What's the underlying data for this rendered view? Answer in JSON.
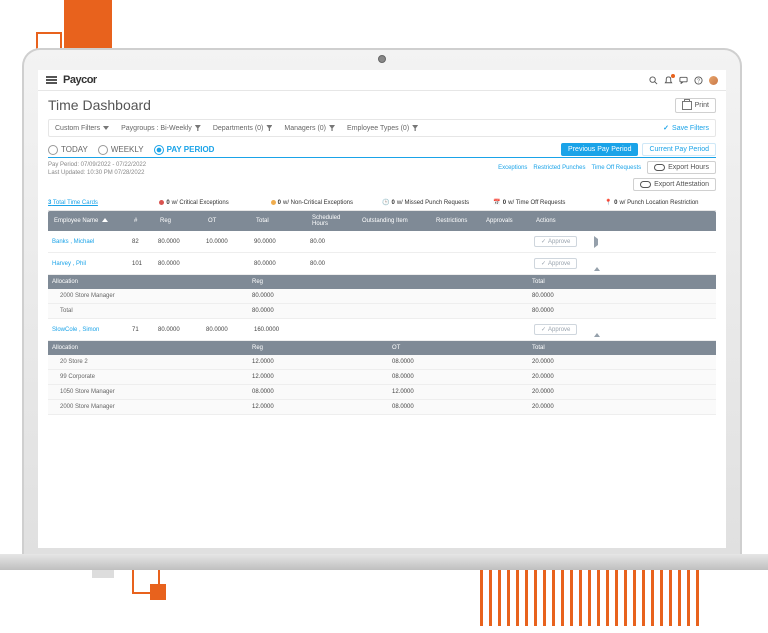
{
  "header": {
    "logo": "Paycor",
    "icons": [
      "search-icon",
      "bell-icon",
      "chat-icon",
      "help-icon",
      "avatar"
    ]
  },
  "page": {
    "title": "Time Dashboard",
    "print": "Print"
  },
  "filters": {
    "custom": "Custom Filters",
    "paygroups": "Paygroups : Bi-Weekly",
    "departments": "Departments (0)",
    "managers": "Managers (0)",
    "emptypes": "Employee Types (0)",
    "save": "Save Filters"
  },
  "ranges": {
    "today": "TODAY",
    "weekly": "WEEKLY",
    "payperiod": "PAY PERIOD",
    "prev": "Previous Pay Period",
    "curr": "Current Pay Period"
  },
  "meta": {
    "period": "Pay Period: 07/09/2022 - 07/22/2022",
    "updated": "Last Updated: 10:30 PM 07/28/2022",
    "tabs": {
      "exc": "Exceptions",
      "restr": "Restricted Punches",
      "tor": "Time Off Requests"
    },
    "exportHours": "Export Hours",
    "exportAtt": "Export Attestation"
  },
  "summary": {
    "total": {
      "n": "3",
      "label": "Total Time Cards"
    },
    "crit": {
      "n": "0",
      "label": "w/ Critical Exceptions"
    },
    "noncrit": {
      "n": "0",
      "label": "w/ Non-Critical Exceptions"
    },
    "missed": {
      "n": "0",
      "label": "w/ Missed Punch Requests"
    },
    "tor": {
      "n": "0",
      "label": "w/ Time Off Requests"
    },
    "loc": {
      "n": "0",
      "label": "w/ Punch Location Restriction"
    }
  },
  "cols": {
    "name": "Employee Name",
    "num": "#",
    "reg": "Reg",
    "ot": "OT",
    "total": "Total",
    "sched": "Scheduled Hours",
    "out": "Outstanding Item",
    "restr": "Restrictions",
    "appr": "Approvals",
    "act": "Actions"
  },
  "rows": [
    {
      "name": "Banks , Michael",
      "num": "82",
      "reg": "80.0000",
      "ot": "10.0000",
      "total": "90.0000",
      "sched": "80.00",
      "approve": "Approve",
      "expand": "right"
    },
    {
      "name": "Harvey , Phil",
      "num": "101",
      "reg": "80.0000",
      "ot": "",
      "total": "80.0000",
      "sched": "80.00",
      "approve": "Approve",
      "expand": "up"
    }
  ],
  "alloc1": {
    "head": {
      "a": "Allocation",
      "b": "Reg",
      "c": "",
      "d": "Total"
    },
    "rows": [
      {
        "a": "2000 Store Manager",
        "b": "80.0000",
        "c": "",
        "d": "80.0000"
      },
      {
        "a": "Total",
        "b": "80.0000",
        "c": "",
        "d": "80.0000"
      }
    ]
  },
  "row3": {
    "name": "SlowCole , Simon",
    "num": "71",
    "reg": "80.0000",
    "ot": "80.0000",
    "total": "160.0000",
    "approve": "Approve",
    "expand": "up"
  },
  "alloc2": {
    "head": {
      "a": "Allocation",
      "b": "Reg",
      "c": "OT",
      "d": "Total"
    },
    "rows": [
      {
        "a": "20 Store 2",
        "b": "12.0000",
        "c": "08.0000",
        "d": "20.0000"
      },
      {
        "a": "99 Corporate",
        "b": "12.0000",
        "c": "08.0000",
        "d": "20.0000"
      },
      {
        "a": "1050 Store Manager",
        "b": "08.0000",
        "c": "12.0000",
        "d": "20.0000"
      },
      {
        "a": "2000 Store Manager",
        "b": "12.0000",
        "c": "08.0000",
        "d": "20.0000"
      }
    ]
  }
}
